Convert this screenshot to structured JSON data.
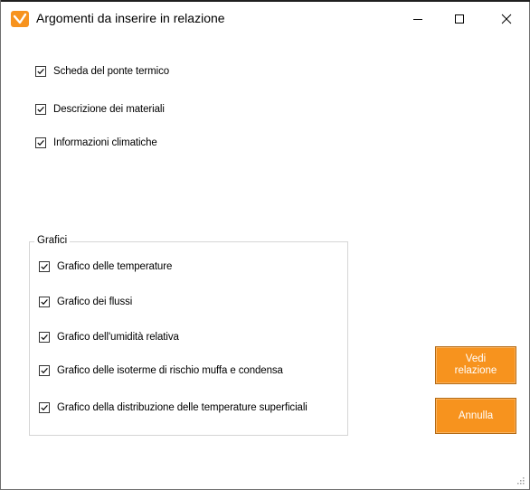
{
  "window": {
    "title": "Argomenti da inserire in relazione",
    "controls": [
      "minimize-icon",
      "maximize-icon",
      "close-icon"
    ]
  },
  "options": [
    {
      "label": "Scheda del ponte termico",
      "checked": true
    },
    {
      "label": "Descrizione dei materiali",
      "checked": true
    },
    {
      "label": "Informazioni climatiche",
      "checked": true
    }
  ],
  "charts_group": {
    "title": "Grafici",
    "items": [
      {
        "label": "Grafico delle temperature",
        "checked": true
      },
      {
        "label": "Grafico dei flussi",
        "checked": true
      },
      {
        "label": "Grafico dell'umidità relativa",
        "checked": true
      },
      {
        "label": "Grafico delle isoterme di rischio muffa e condensa",
        "checked": true
      },
      {
        "label": "Grafico della distribuzione delle temperature superficiali",
        "checked": true
      }
    ]
  },
  "buttons": {
    "view_report_line1": "Vedi",
    "view_report_line2": "relazione",
    "cancel": "Annulla"
  },
  "colors": {
    "accent": "#f7931e",
    "icon": "#f7931e"
  }
}
